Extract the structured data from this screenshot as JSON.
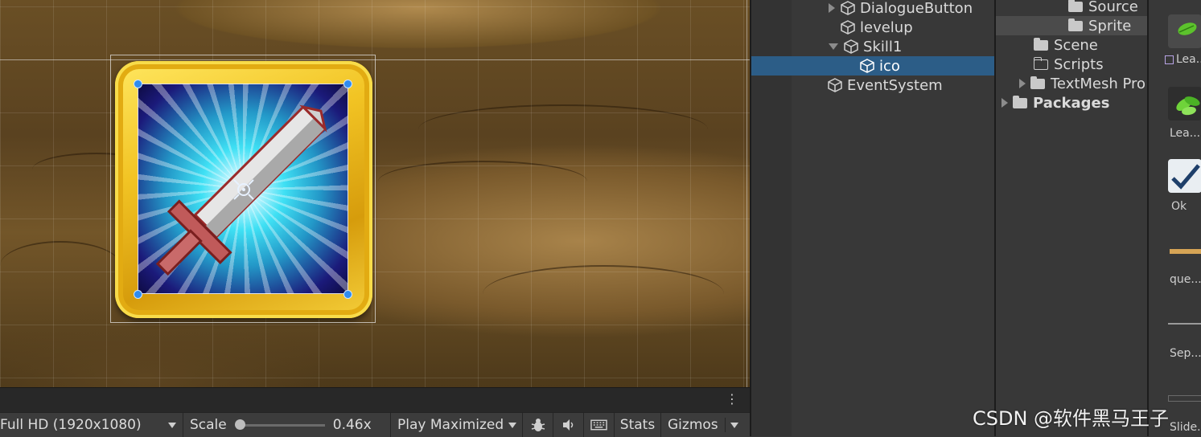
{
  "toolbar": {
    "resolution": "Full HD (1920x1080)",
    "scale_label": "Scale",
    "scale_value": "0.46x",
    "play_mode": "Play Maximized",
    "stats_label": "Stats",
    "gizmos_label": "Gizmos",
    "icons": [
      "bug-icon",
      "speaker-icon",
      "keyboard-icon"
    ]
  },
  "hierarchy": {
    "items": [
      {
        "label": "DialogueButton",
        "expandable": true,
        "expanded": false
      },
      {
        "label": "levelup",
        "expandable": false
      },
      {
        "label": "Skill1",
        "expandable": true,
        "expanded": true
      },
      {
        "label": "ico",
        "expandable": false,
        "selected": true
      },
      {
        "label": "EventSystem",
        "expandable": false
      }
    ]
  },
  "project": {
    "items": [
      {
        "label": "Source",
        "expandable": false
      },
      {
        "label": "Sprite",
        "expandable": false,
        "selected": true
      },
      {
        "label": "Scene",
        "expandable": false
      },
      {
        "label": "Scripts",
        "expandable": false
      },
      {
        "label": "TextMesh Pro",
        "expandable": true
      },
      {
        "label": "Packages",
        "expandable": true
      }
    ]
  },
  "assets": {
    "items": [
      "Lea...",
      "Lea...",
      "Ok",
      "que...",
      "Sep...",
      "Slide..."
    ]
  },
  "colors": {
    "selection": "#2c5d87",
    "handle": "#2f8cf0",
    "frame_gold": "#f2c424"
  },
  "watermark": "CSDN @软件黑马王子"
}
